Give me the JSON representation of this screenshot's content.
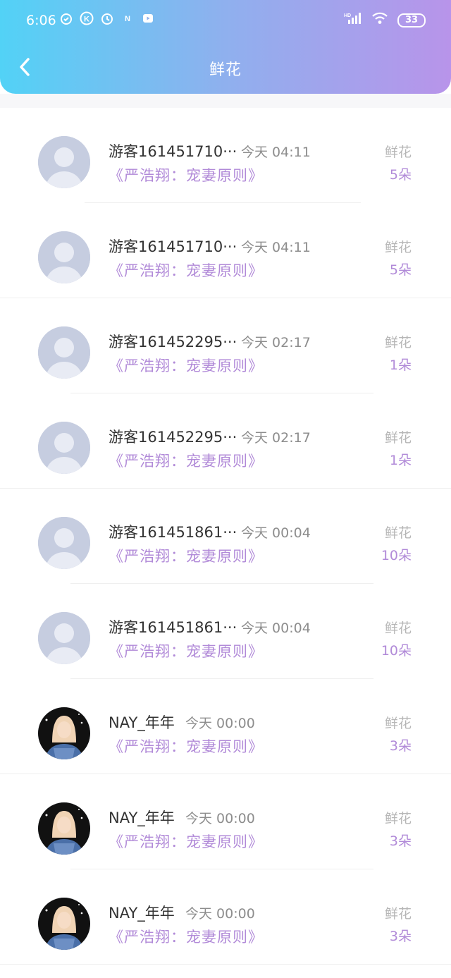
{
  "status_bar": {
    "time": "6:06",
    "battery": "33",
    "network": "HD"
  },
  "header": {
    "title": "鲜花"
  },
  "rows": [
    {
      "name": "游客161451710···",
      "time": "今天  04:11",
      "book": "《严浩翔：宠妻原则》",
      "label": "鲜花",
      "count": "5朵",
      "avatar": "default"
    },
    {
      "name": "游客161451710···",
      "time": "今天  04:11",
      "book": "《严浩翔：宠妻原则》",
      "label": "鲜花",
      "count": "5朵",
      "avatar": "default"
    },
    {
      "name": "游客161452295···",
      "time": "今天  02:17",
      "book": "《严浩翔：宠妻原则》",
      "label": "鲜花",
      "count": "1朵",
      "avatar": "default"
    },
    {
      "name": "游客161452295···",
      "time": "今天  02:17",
      "book": "《严浩翔：宠妻原则》",
      "label": "鲜花",
      "count": "1朵",
      "avatar": "default"
    },
    {
      "name": "游客161451861···",
      "time": "今天  00:04",
      "book": "《严浩翔：宠妻原则》",
      "label": "鲜花",
      "count": "10朵",
      "avatar": "default"
    },
    {
      "name": "游客161451861···",
      "time": "今天  00:04",
      "book": "《严浩翔：宠妻原则》",
      "label": "鲜花",
      "count": "10朵",
      "avatar": "default"
    },
    {
      "name": "NAY_年年",
      "time": "今天  00:00",
      "book": "《严浩翔：宠妻原则》",
      "label": "鲜花",
      "count": "3朵",
      "avatar": "photo"
    },
    {
      "name": "NAY_年年",
      "time": "今天  00:00",
      "book": "《严浩翔：宠妻原则》",
      "label": "鲜花",
      "count": "3朵",
      "avatar": "photo"
    },
    {
      "name": "NAY_年年",
      "time": "今天  00:00",
      "book": "《严浩翔：宠妻原则》",
      "label": "鲜花",
      "count": "3朵",
      "avatar": "photo"
    }
  ]
}
